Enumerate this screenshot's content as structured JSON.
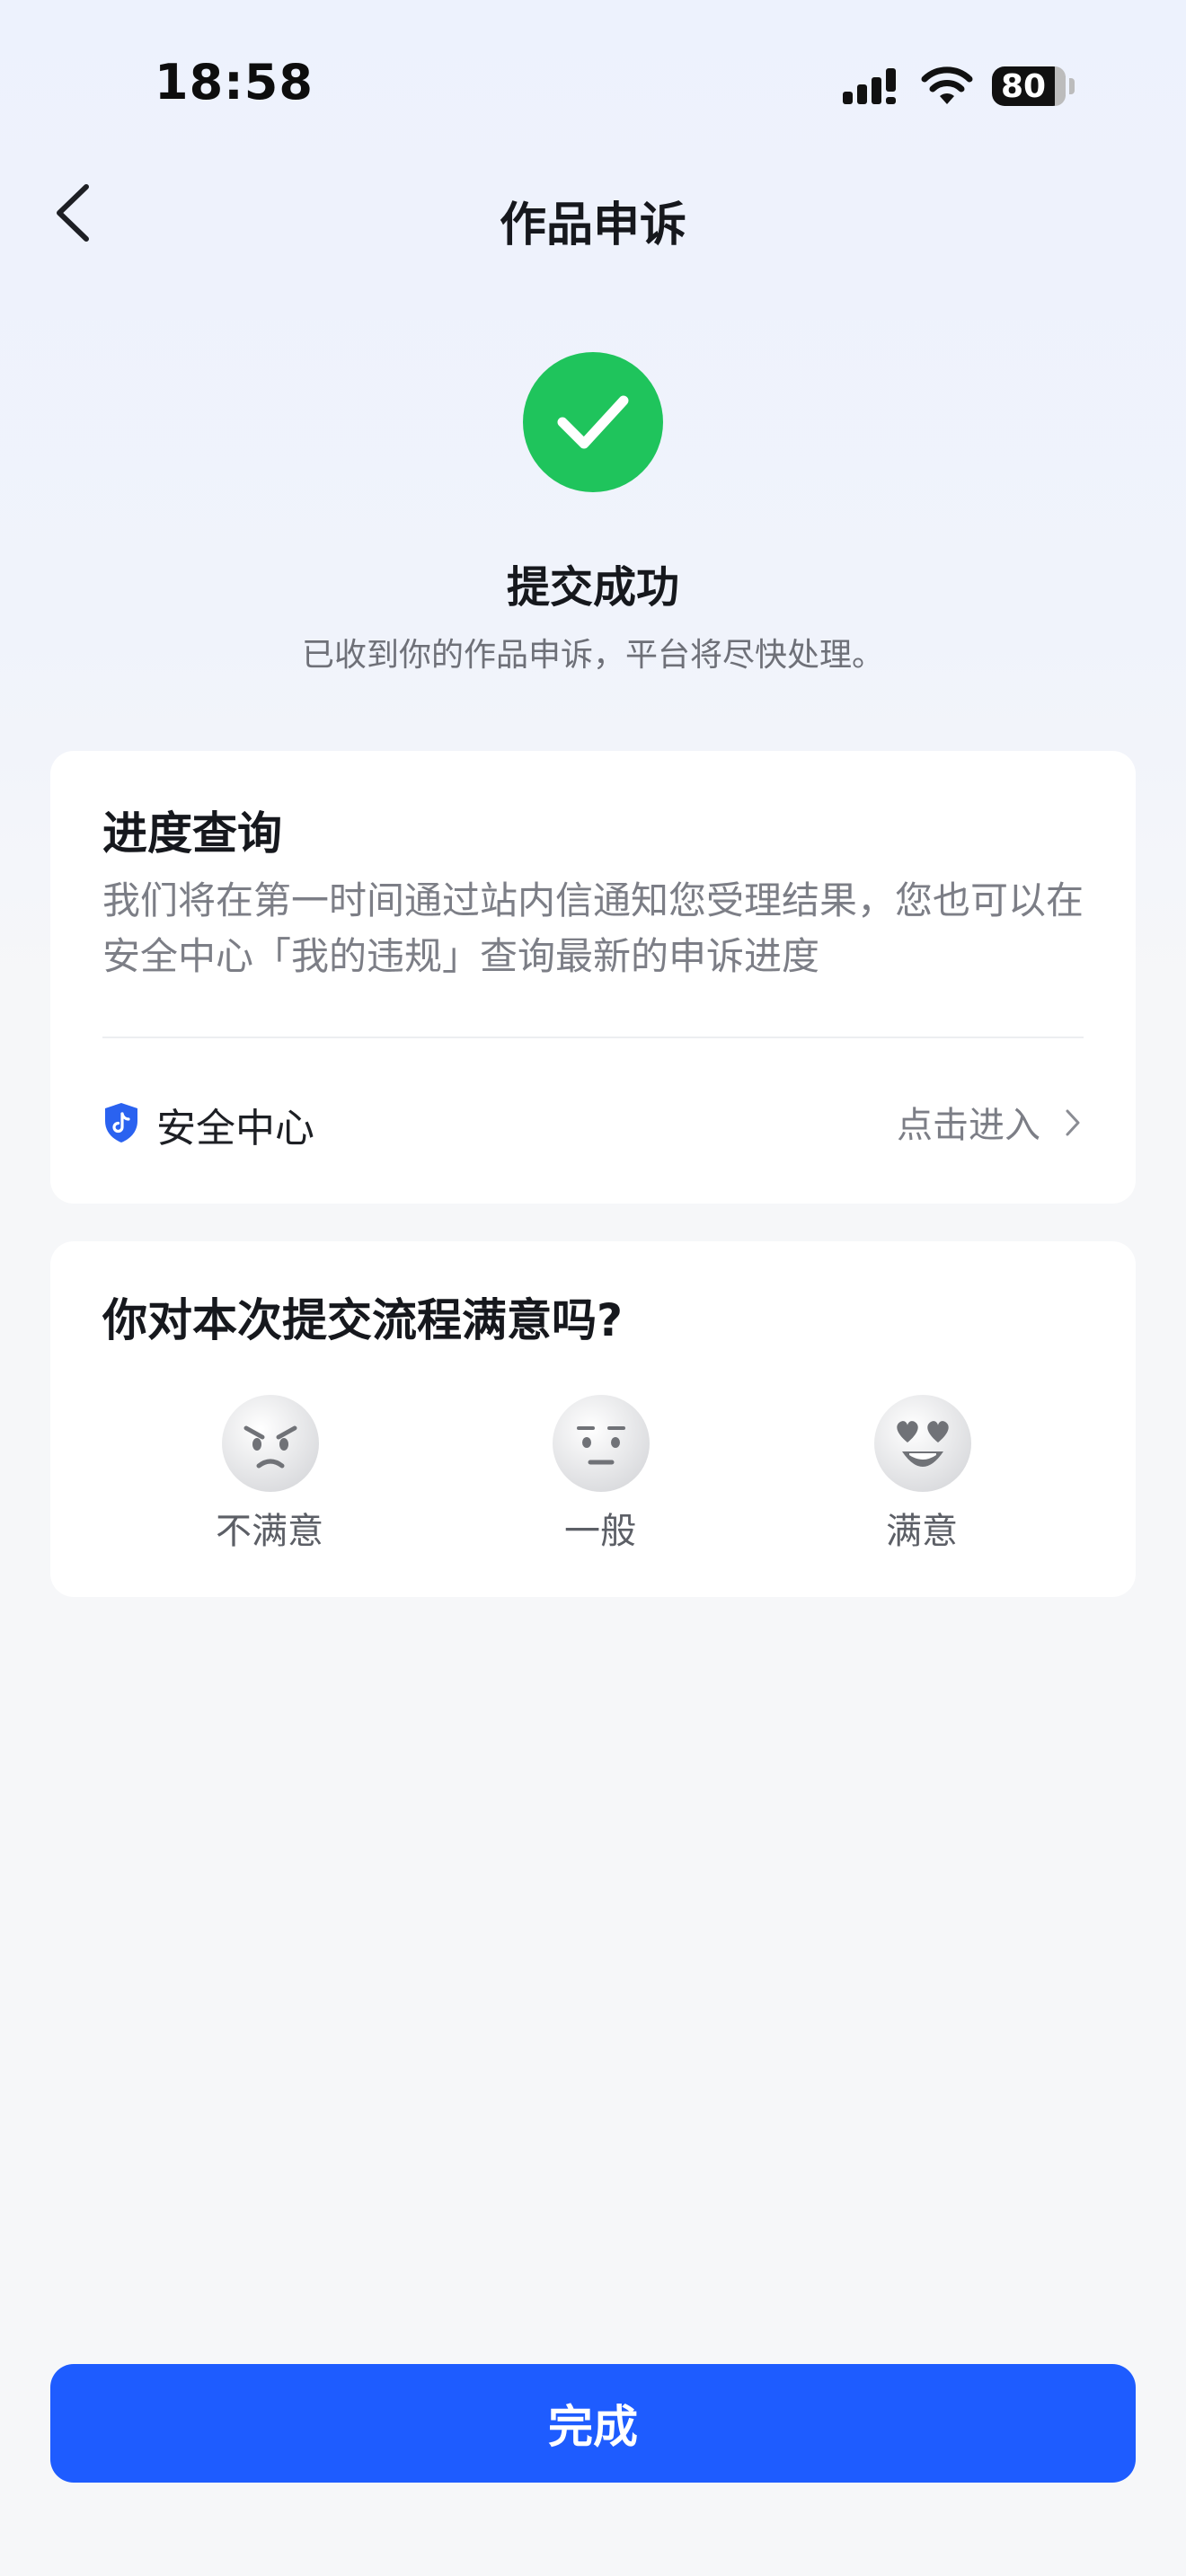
{
  "status_bar": {
    "time": "18:58",
    "battery": "80",
    "icons": [
      "signal-icon",
      "wifi-icon",
      "battery-icon"
    ]
  },
  "nav": {
    "title": "作品申诉",
    "back_icon": "chevron-left-icon"
  },
  "success": {
    "icon": "check-icon",
    "title": "提交成功",
    "subtitle": "已收到你的作品申诉，平台将尽快处理。"
  },
  "progress_card": {
    "title": "进度查询",
    "description": "我们将在第一时间通过站内信通知您受理结果，您也可以在安全中心「我的违规」查询最新的申诉进度",
    "link_label": "安全中心",
    "link_action": "点击进入",
    "link_icon": "shield-icon"
  },
  "survey": {
    "question": "你对本次提交流程满意吗?",
    "options": [
      {
        "label": "不满意",
        "icon": "angry-face-icon"
      },
      {
        "label": "一般",
        "icon": "neutral-face-icon"
      },
      {
        "label": "满意",
        "icon": "heart-eyes-face-icon"
      }
    ]
  },
  "footer": {
    "done_label": "完成"
  },
  "colors": {
    "accent": "#1e5cff",
    "success": "#1fc45c",
    "shield": "#2a62f0"
  }
}
